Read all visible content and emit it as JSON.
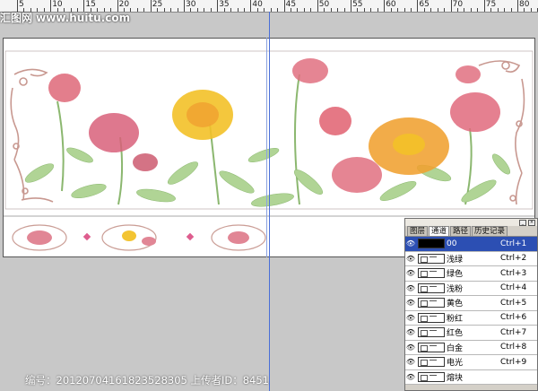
{
  "ruler": {
    "numbers": [
      "5",
      "10",
      "15",
      "20",
      "25",
      "30",
      "35",
      "40",
      "45",
      "50",
      "55",
      "60",
      "65",
      "70",
      "75",
      "80"
    ]
  },
  "watermark": {
    "top": "汇图网 www.huitu.com",
    "footer": "编号：20120704161823528305 上传者ID：8451"
  },
  "channels_panel": {
    "tabs": [
      "图层",
      "通道",
      "路径",
      "历史记录"
    ],
    "active_tab": "通道",
    "channels": [
      {
        "name": "00",
        "shortcut": "Ctrl+1",
        "selected": true
      },
      {
        "name": "浅绿",
        "shortcut": "Ctrl+2",
        "selected": false
      },
      {
        "name": "绿色",
        "shortcut": "Ctrl+3",
        "selected": false
      },
      {
        "name": "浅粉",
        "shortcut": "Ctrl+4",
        "selected": false
      },
      {
        "name": "黄色",
        "shortcut": "Ctrl+5",
        "selected": false
      },
      {
        "name": "粉红",
        "shortcut": "Ctrl+6",
        "selected": false
      },
      {
        "name": "红色",
        "shortcut": "Ctrl+7",
        "selected": false
      },
      {
        "name": "白金",
        "shortcut": "Ctrl+8",
        "selected": false
      },
      {
        "name": "电光",
        "shortcut": "Ctrl+9",
        "selected": false
      },
      {
        "name": "熔块",
        "shortcut": "",
        "selected": false
      }
    ]
  },
  "colors": {
    "selected_row": "#2c4fb3",
    "guide": "#4a6fd8",
    "pink": "#e0707f",
    "yellow": "#f3c128",
    "orange": "#f0a030",
    "green": "#8fc06a",
    "scroll_brown": "#c89890"
  }
}
